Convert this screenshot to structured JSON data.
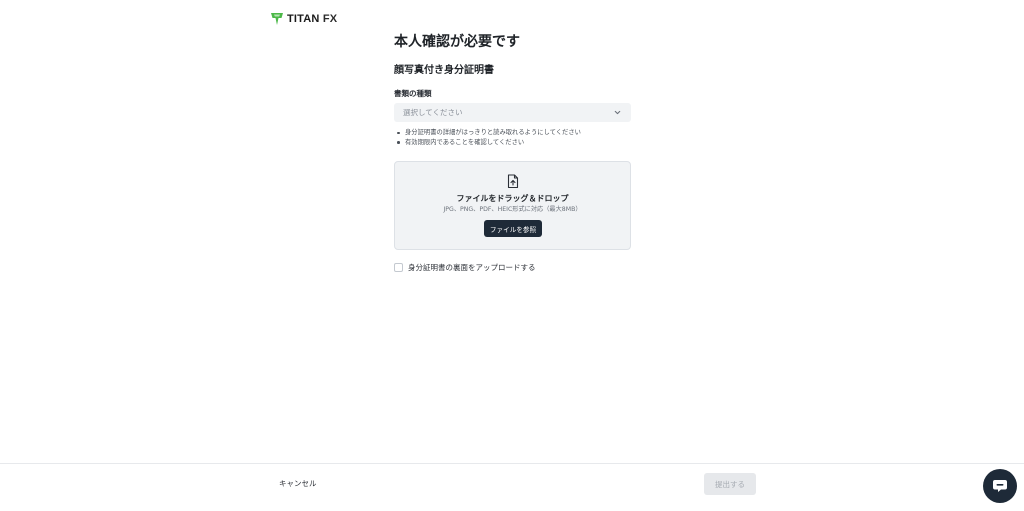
{
  "brand": {
    "logo_main": "TITAN",
    "logo_suffix": "FX",
    "accent": "#4cb848"
  },
  "page": {
    "title": "本人確認が必要です",
    "section_title": "顔写真付き身分証明書"
  },
  "document_type": {
    "label": "書類の種類",
    "placeholder": "選択してください",
    "icon": "chevron-down-icon"
  },
  "hints": [
    "身分証明書の詳細がはっきりと読み取れるようにしてください",
    "有効期限内であることを確認してください"
  ],
  "dropzone": {
    "icon": "file-upload-icon",
    "title": "ファイルをドラッグ＆ドロップ",
    "subtitle": "JPG、PNG、PDF、HEIC形式に対応（最大8MB）",
    "browse_button": "ファイルを参照"
  },
  "back_side": {
    "label": "身分証明書の裏面をアップロードする",
    "checked": false
  },
  "footer": {
    "cancel": "キャンセル",
    "submit": "提出する"
  },
  "chat": {
    "icon": "chat-bubble-icon"
  }
}
